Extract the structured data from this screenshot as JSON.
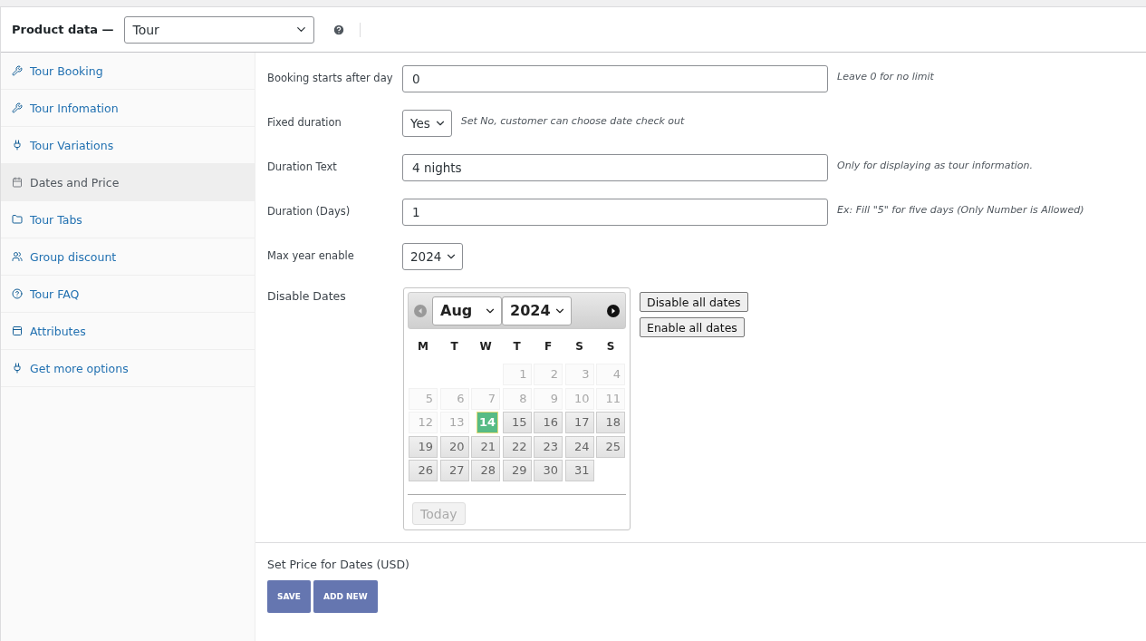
{
  "header": {
    "title": "Product data —",
    "product_type": "Tour"
  },
  "sidebar": {
    "items": [
      {
        "label": "Tour Booking",
        "selected": false
      },
      {
        "label": "Tour Infomation",
        "selected": false
      },
      {
        "label": "Tour Variations",
        "selected": false
      },
      {
        "label": "Dates and Price",
        "selected": true
      },
      {
        "label": "Tour Tabs",
        "selected": false
      },
      {
        "label": "Group discount",
        "selected": false
      },
      {
        "label": "Tour FAQ",
        "selected": false
      },
      {
        "label": "Attributes",
        "selected": false
      },
      {
        "label": "Get more options",
        "selected": false
      }
    ]
  },
  "fields": [
    {
      "kind": "text",
      "label": "Booking starts after day",
      "value": "0",
      "hint": "Leave 0 for no limit"
    },
    {
      "kind": "select",
      "label": "Fixed duration",
      "value": "Yes",
      "hint": "Set No, customer can choose date check out"
    },
    {
      "kind": "text",
      "label": "Duration Text",
      "value": "4 nights",
      "hint": "Only for displaying as tour information."
    },
    {
      "kind": "text",
      "label": "Duration (Days)",
      "value": "1",
      "hint": "Ex: Fill \"5\" for five days (Only Number is Allowed)"
    },
    {
      "kind": "select",
      "label": "Max year enable",
      "value": "2024"
    }
  ],
  "disable_dates": {
    "label": "Disable Dates",
    "month": "Aug",
    "year": "2024",
    "weekdays": [
      "M",
      "T",
      "W",
      "T",
      "F",
      "S",
      "S"
    ],
    "days": [
      {
        "kind": "blank"
      },
      {
        "kind": "blank"
      },
      {
        "kind": "blank"
      },
      {
        "kind": "day",
        "label": "1",
        "disabled": true,
        "selected": false
      },
      {
        "kind": "day",
        "label": "2",
        "disabled": true,
        "selected": false
      },
      {
        "kind": "day",
        "label": "3",
        "disabled": true,
        "selected": false
      },
      {
        "kind": "day",
        "label": "4",
        "disabled": true,
        "selected": false
      },
      {
        "kind": "day",
        "label": "5",
        "disabled": true,
        "selected": false
      },
      {
        "kind": "day",
        "label": "6",
        "disabled": true,
        "selected": false
      },
      {
        "kind": "day",
        "label": "7",
        "disabled": true,
        "selected": false
      },
      {
        "kind": "day",
        "label": "8",
        "disabled": true,
        "selected": false
      },
      {
        "kind": "day",
        "label": "9",
        "disabled": true,
        "selected": false
      },
      {
        "kind": "day",
        "label": "10",
        "disabled": true,
        "selected": false
      },
      {
        "kind": "day",
        "label": "11",
        "disabled": true,
        "selected": false
      },
      {
        "kind": "day",
        "label": "12",
        "disabled": true,
        "selected": false
      },
      {
        "kind": "day",
        "label": "13",
        "disabled": true,
        "selected": false
      },
      {
        "kind": "day",
        "label": "14",
        "disabled": false,
        "selected": true
      },
      {
        "kind": "day",
        "label": "15",
        "disabled": false,
        "selected": false
      },
      {
        "kind": "day",
        "label": "16",
        "disabled": false,
        "selected": false
      },
      {
        "kind": "day",
        "label": "17",
        "disabled": false,
        "selected": false
      },
      {
        "kind": "day",
        "label": "18",
        "disabled": false,
        "selected": false
      },
      {
        "kind": "day",
        "label": "19",
        "disabled": false,
        "selected": false
      },
      {
        "kind": "day",
        "label": "20",
        "disabled": false,
        "selected": false
      },
      {
        "kind": "day",
        "label": "21",
        "disabled": false,
        "selected": false
      },
      {
        "kind": "day",
        "label": "22",
        "disabled": false,
        "selected": false
      },
      {
        "kind": "day",
        "label": "23",
        "disabled": false,
        "selected": false
      },
      {
        "kind": "day",
        "label": "24",
        "disabled": false,
        "selected": false
      },
      {
        "kind": "day",
        "label": "25",
        "disabled": false,
        "selected": false
      },
      {
        "kind": "day",
        "label": "26",
        "disabled": false,
        "selected": false
      },
      {
        "kind": "day",
        "label": "27",
        "disabled": false,
        "selected": false
      },
      {
        "kind": "day",
        "label": "28",
        "disabled": false,
        "selected": false
      },
      {
        "kind": "day",
        "label": "29",
        "disabled": false,
        "selected": false
      },
      {
        "kind": "day",
        "label": "30",
        "disabled": false,
        "selected": false
      },
      {
        "kind": "day",
        "label": "31",
        "disabled": false,
        "selected": false
      }
    ],
    "today_button": "Today",
    "buttons": [
      "Disable all dates",
      "Enable all dates"
    ]
  },
  "price_section": {
    "title": "Set Price for Dates (USD)",
    "buttons": [
      "SAVE",
      "ADD NEW"
    ]
  }
}
